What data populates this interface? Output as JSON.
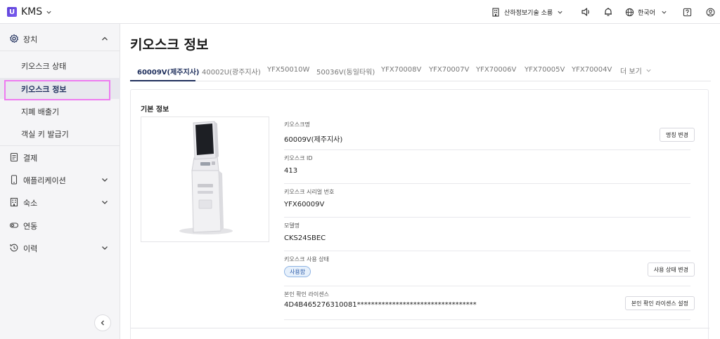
{
  "header": {
    "app_name": "KMS",
    "store_name": "산하정보기술 소룡",
    "language": "한국어"
  },
  "sidebar": {
    "device_group": "장치",
    "items": [
      {
        "label": "키오스크 상태"
      },
      {
        "label": "키오스크 정보"
      },
      {
        "label": "지폐 배출기"
      },
      {
        "label": "객실 키 발급기"
      }
    ],
    "payment": "결제",
    "applications": "애플리케이션",
    "lodging": "숙소",
    "integration": "연동",
    "history": "이력"
  },
  "page": {
    "title": "키오스크 정보",
    "tabs": [
      {
        "label": "60009V(제주지사)"
      },
      {
        "label": "40002U(광주지사)"
      },
      {
        "label": "YFX50010W"
      },
      {
        "label": "50036V(동일타워)"
      },
      {
        "label": "YFX70008V"
      },
      {
        "label": "YFX70007V"
      },
      {
        "label": "YFX70006V"
      },
      {
        "label": "YFX70005V"
      },
      {
        "label": "YFX70004V"
      },
      {
        "label": "더 보기"
      }
    ],
    "section_title": "기본 정보",
    "fields": {
      "name_label": "키오스크명",
      "name_value": "60009V(제주지사)",
      "rename_button": "명칭 변경",
      "id_label": "키오스크 ID",
      "id_value": "413",
      "serial_label": "키오스크 시리얼 번호",
      "serial_value": "YFX60009V",
      "model_label": "모델명",
      "model_value": "CKS24SBEC",
      "status_label": "키오스크 사용 상태",
      "status_badge": "사용함",
      "status_button": "사용 상태 변경",
      "license_label": "본인 확인 라이센스",
      "license_value": "4D4B465276310081**********************************",
      "license_button": "본인 확인 라이센스 설정"
    }
  },
  "colors": {
    "accent": "#1f2f5c",
    "highlight": "#ee7bf0",
    "badge_text": "#2b5aa8",
    "badge_bg": "#e6f0fb"
  }
}
